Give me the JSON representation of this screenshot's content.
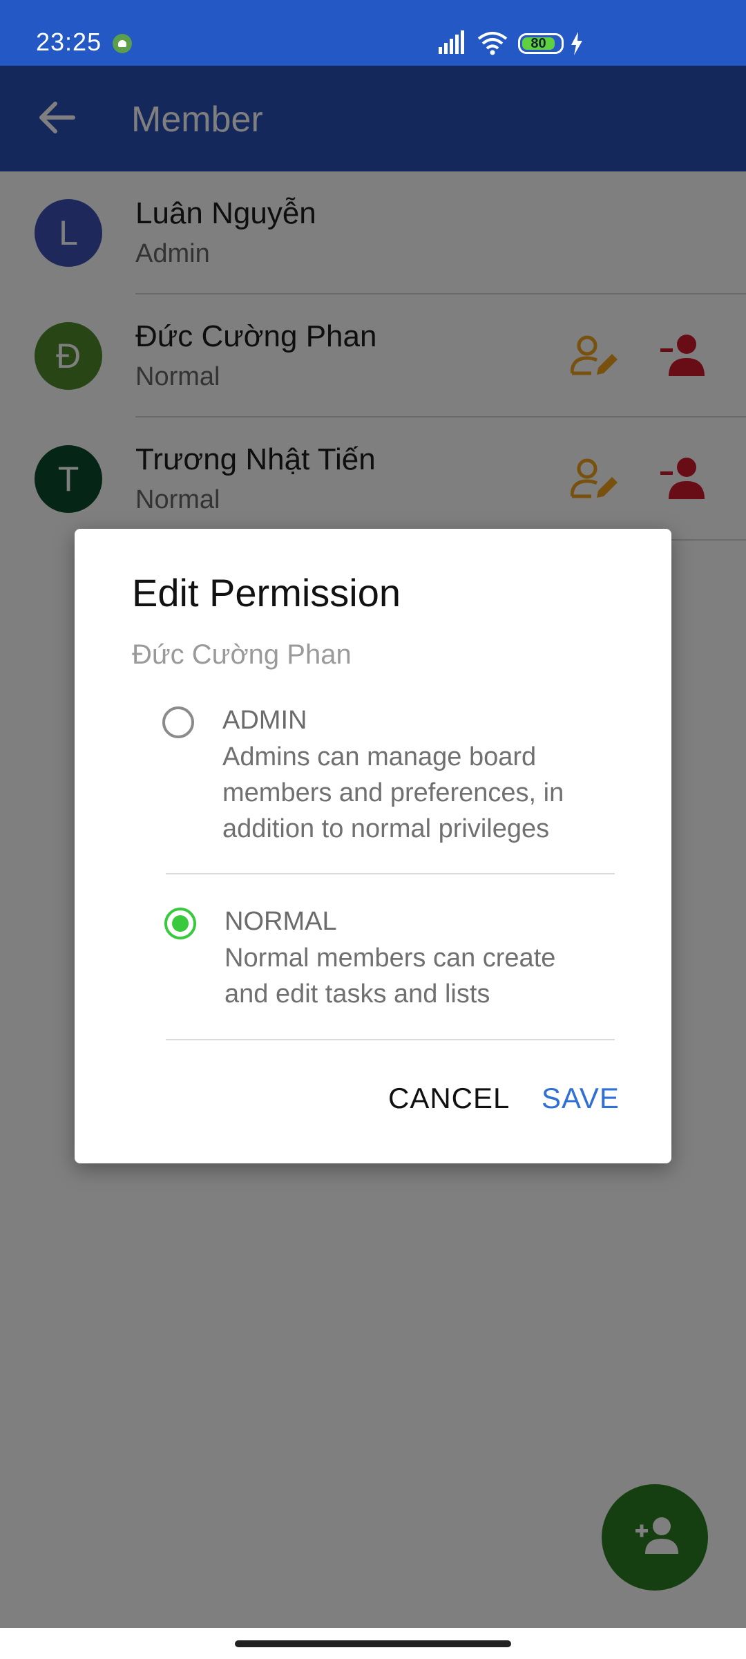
{
  "status_bar": {
    "time": "23:25",
    "battery_level": "80",
    "icons": [
      "android-icon",
      "signal-icon",
      "wifi-icon",
      "battery-icon",
      "charging-icon"
    ]
  },
  "app_bar": {
    "title": "Member",
    "back_icon": "arrow-back-icon"
  },
  "members": [
    {
      "initial": "L",
      "name": "Luân Nguyễn",
      "role": "Admin",
      "avatar_color": "#3f51b5"
    },
    {
      "initial": "Đ",
      "name": "Đức Cường Phan",
      "role": "Normal",
      "avatar_color": "#4e8a2a"
    },
    {
      "initial": "T",
      "name": "Trương Nhật Tiến",
      "role": "Normal",
      "avatar_color": "#0b4a2c"
    }
  ],
  "dialog": {
    "title": "Edit Permission",
    "subtitle": "Đức Cường Phan",
    "options": [
      {
        "label": "ADMIN",
        "description": "Admins can manage board members and preferences, in addition to normal privileges",
        "selected": false
      },
      {
        "label": "NORMAL",
        "description": "Normal members can create and edit tasks and lists",
        "selected": true
      }
    ],
    "cancel_label": "CANCEL",
    "save_label": "SAVE"
  },
  "fab": {
    "icon": "add-person-icon"
  },
  "colors": {
    "status_bar": "#2358c5",
    "app_bar": "#2a51b6",
    "edit_icon": "#f0a21f",
    "remove_icon": "#d11a2a",
    "radio_selected": "#38c93c",
    "save_button": "#2f6fd6",
    "fab": "#2d7e22"
  }
}
